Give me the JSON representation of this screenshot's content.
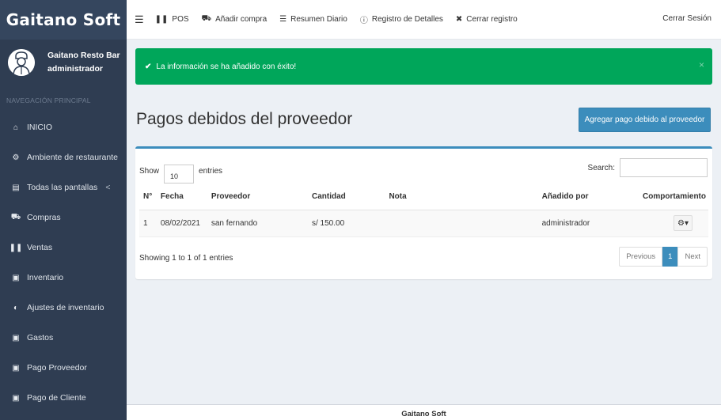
{
  "brand": "Gaitano Soft",
  "user": {
    "name": "Gaitano Resto Bar",
    "role": "administrador"
  },
  "sidebar": {
    "header": "NAVEGACIÓN PRINCIPAL",
    "items": [
      {
        "label": "INICIO",
        "icon": "home-icon"
      },
      {
        "label": "Ambiente de restaurante",
        "icon": "gear-icon"
      },
      {
        "label": "Todas las pantallas",
        "icon": "file-icon",
        "caret": "<"
      },
      {
        "label": "Compras",
        "icon": "truck-icon"
      },
      {
        "label": "Ventas",
        "icon": "cutlery-icon"
      },
      {
        "label": "Inventario",
        "icon": "inbox-icon"
      },
      {
        "label": "Ajustes de inventario",
        "icon": "adjust-icon"
      },
      {
        "label": "Gastos",
        "icon": "money-icon"
      },
      {
        "label": "Pago Proveedor",
        "icon": "money-icon"
      },
      {
        "label": "Pago de Cliente",
        "icon": "money-icon"
      }
    ]
  },
  "topbar": {
    "links": [
      {
        "label": "POS",
        "icon": "cutlery-icon"
      },
      {
        "label": "Añadir compra",
        "icon": "truck-icon"
      },
      {
        "label": "Resumen Diario",
        "icon": "list-icon"
      },
      {
        "label": "Registro de Detalles",
        "icon": "info-icon"
      },
      {
        "label": "Cerrar registro",
        "icon": "close-circle-icon"
      }
    ],
    "logout": "Cerrar Sesión"
  },
  "alert": {
    "message": "La información se ha añadido con éxito!",
    "close": "×",
    "color": "#00a65a"
  },
  "page": {
    "title": "Pagos debidos del proveedor",
    "add_button": "Agregar pago debido al proveedor"
  },
  "table_controls": {
    "show": "Show",
    "length": "10",
    "entries": "entries",
    "search": "Search:"
  },
  "table": {
    "columns": [
      "N°",
      "Fecha",
      "Proveedor",
      "Cantidad",
      "Nota",
      "Añadido por",
      "Comportamiento"
    ],
    "rows": [
      {
        "n": "1",
        "fecha": "08/02/2021",
        "proveedor": "san fernando",
        "cantidad": "s/ 150.00",
        "nota": "",
        "anadido_por": "administrador"
      }
    ]
  },
  "table_info": "Showing 1 to 1 of 1 entries",
  "pagination": {
    "previous": "Previous",
    "current": "1",
    "next": "Next"
  },
  "footer": "Gaitano Soft",
  "colors": {
    "sidebar": "#2f3d52",
    "primary": "#3c8dbc",
    "success": "#00a65a"
  }
}
